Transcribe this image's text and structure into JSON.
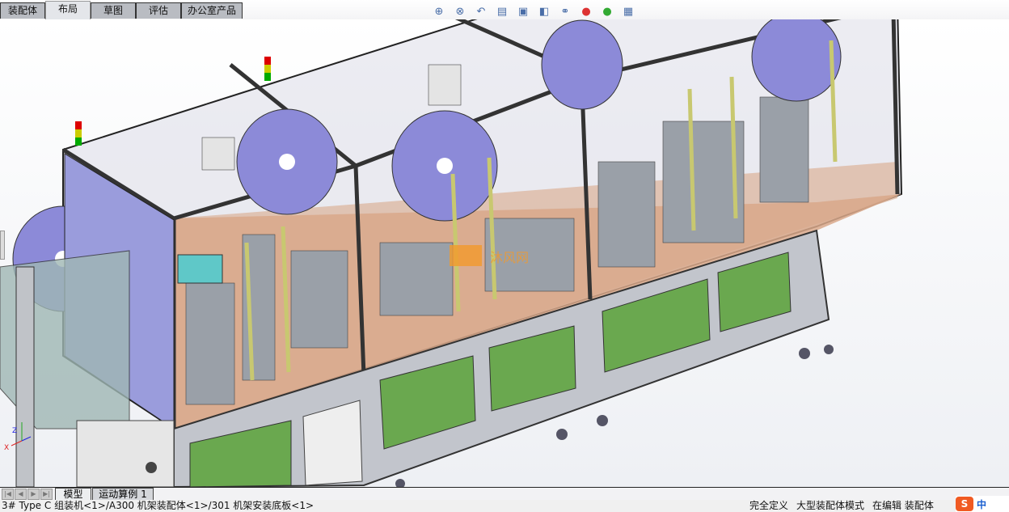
{
  "command_tabs": [
    {
      "label": "装配体",
      "active": false
    },
    {
      "label": "布局",
      "active": true
    },
    {
      "label": "草图",
      "active": false
    },
    {
      "label": "评估",
      "active": false
    },
    {
      "label": "办公室产品",
      "active": false
    }
  ],
  "heads_up_toolbar": [
    "zoom-to-fit-icon",
    "zoom-area-icon",
    "previous-view-icon",
    "section-view-icon",
    "view-orientation-icon",
    "display-style-icon",
    "hide-show-icon",
    "edit-appearance-icon",
    "apply-scene-icon",
    "view-settings-icon"
  ],
  "watermark": "沐风网",
  "triad": {
    "x": "X",
    "y": "Y",
    "z": "Z"
  },
  "bottom_tabs": [
    {
      "label": "模型",
      "active": true
    },
    {
      "label": "运动算例 1",
      "active": false
    }
  ],
  "status": {
    "path": "3# Type C 组装机<1>/A300 机架装配体<1>/301 机架安装底板<1>",
    "definition": "完全定义",
    "mode": "大型装配体模式",
    "editing": "在编辑 装配体"
  },
  "ime": {
    "logo": "S",
    "lang": "中"
  },
  "colors": {
    "reel": "#8c8ad8",
    "panel_green": "#6aa84f",
    "floor": "#d9a88a",
    "frame": "#b9bcc4",
    "enclosure": "#9a9cdc"
  }
}
